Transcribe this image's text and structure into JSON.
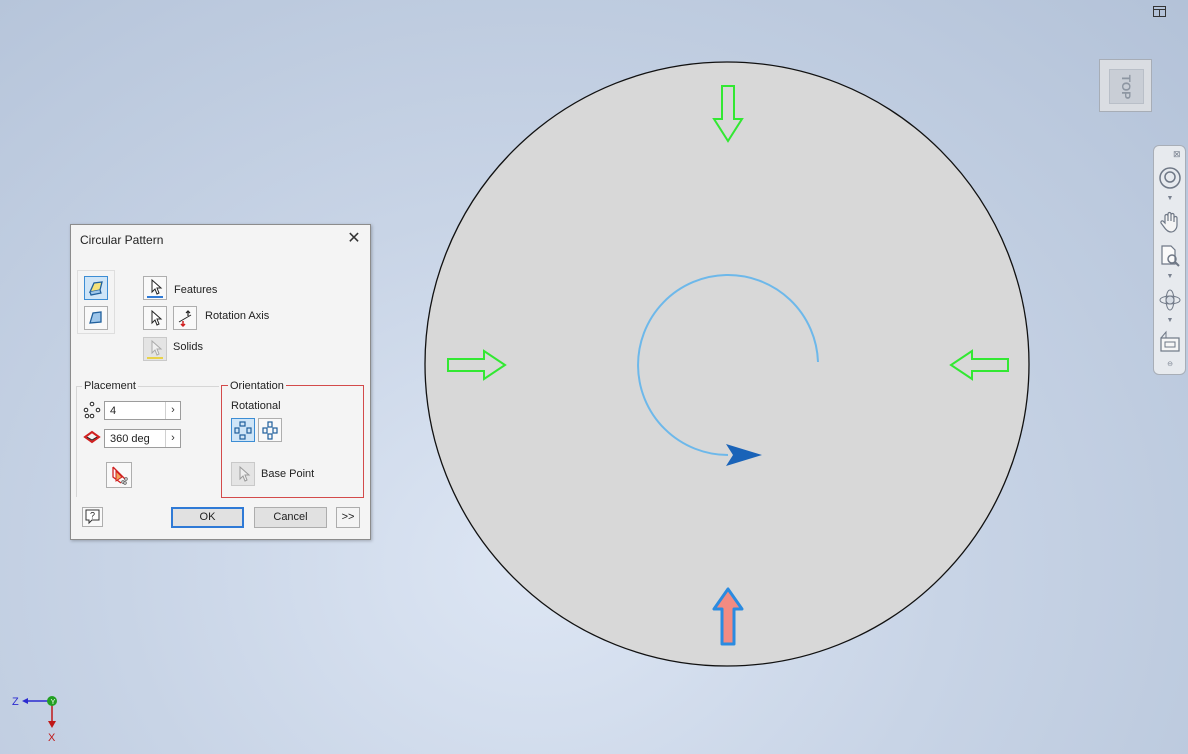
{
  "dialog": {
    "title": "Circular Pattern",
    "features_label": "Features",
    "rotation_axis_label": "Rotation Axis",
    "solids_label": "Solids",
    "placement_title": "Placement",
    "count_value": "4",
    "angle_value": "360 deg",
    "orientation_title": "Orientation",
    "rotational_label": "Rotational",
    "base_point_label": "Base Point",
    "ok_label": "OK",
    "cancel_label": "Cancel",
    "more_label": ">>"
  },
  "viewcube": {
    "face_label": "TOP"
  },
  "triad": {
    "z_label": "Z",
    "x_label": "X"
  },
  "colors": {
    "disc_fill": "#d8d8d8",
    "green_arrow": "#32e832",
    "selected_arrow_fill": "#f28b82",
    "selected_arrow_outline": "#2b8be0",
    "rotation_arc": "#6db8ea",
    "rotation_arrowhead": "#1a63b8",
    "orientation_border": "#d34a4a"
  },
  "icons": [
    "window-layout-icon",
    "full-navigation-wheel-icon",
    "pan-hand-icon",
    "zoom-icon",
    "orbit-icon",
    "look-at-icon"
  ]
}
